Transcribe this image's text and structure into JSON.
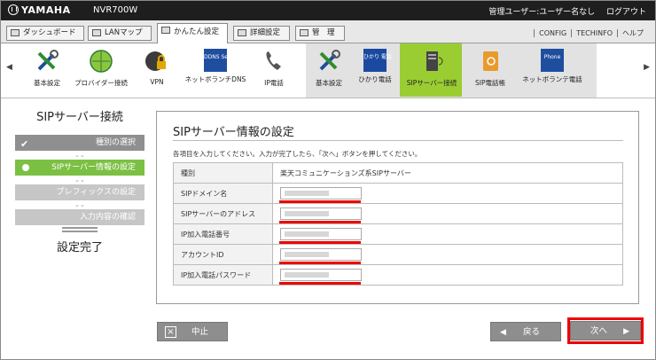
{
  "header": {
    "brand": "YAMAHA",
    "model": "NVR700W",
    "user": "管理ユーザー:ユーザー名なし",
    "logout": "ログアウト"
  },
  "tabs": [
    {
      "label": "ダッシュボード"
    },
    {
      "label": "LANマップ"
    },
    {
      "label": "かんたん設定"
    },
    {
      "label": "詳細設定"
    },
    {
      "label": "管　理"
    }
  ],
  "toplinks": [
    "CONFIG",
    "TECHINFO",
    "ヘルプ"
  ],
  "iconbar": {
    "items": [
      {
        "label": "基本設定",
        "icon": "tools-icon"
      },
      {
        "label": "プロバイダー接続",
        "icon": "globe-icon"
      },
      {
        "label": "VPN",
        "icon": "lock-icon"
      },
      {
        "label": "ネットボランチDNS",
        "icon": "ddns-icon",
        "badge": "DDNS Service"
      },
      {
        "label": "IP電話",
        "icon": "phone-icon"
      },
      {
        "label": "基本設定",
        "icon": "tools-icon"
      },
      {
        "label": "ひかり電話",
        "icon": "hikari-icon",
        "badge": "ひかり 電話"
      },
      {
        "label": "SIPサーバー接続",
        "icon": "sip-server-icon"
      },
      {
        "label": "SIP電話帳",
        "icon": "addressbook-icon"
      },
      {
        "label": "ネットボランテ電話",
        "icon": "netvolante-phone-icon",
        "badge": "Phone"
      }
    ]
  },
  "steps": {
    "title": "SIPサーバー接続",
    "items": [
      {
        "label": "種別の選択",
        "state": "done"
      },
      {
        "label": "SIPサーバー情報の設定",
        "state": "current"
      },
      {
        "label": "プレフィックスの設定",
        "state": "todo"
      },
      {
        "label": "入力内容の確認",
        "state": "todo"
      }
    ],
    "finish": "設定完了"
  },
  "panel": {
    "title": "SIPサーバー情報の設定",
    "description": "各項目を入力してください。入力が完了したら、「次へ」ボタンを押してください。",
    "rows": [
      {
        "label": "種別",
        "value": "楽天コミュニケーションズ系SIPサーバー"
      },
      {
        "label": "SIPドメイン名"
      },
      {
        "label": "SIPサーバーのアドレス"
      },
      {
        "label": "IP加入電話番号"
      },
      {
        "label": "アカウントID"
      },
      {
        "label": "IP加入電話パスワード"
      }
    ]
  },
  "buttons": {
    "cancel": "中止",
    "back": "戻る",
    "next": "次へ"
  },
  "colors": {
    "accent_green": "#7bc043",
    "highlight_red": "#e00000"
  }
}
